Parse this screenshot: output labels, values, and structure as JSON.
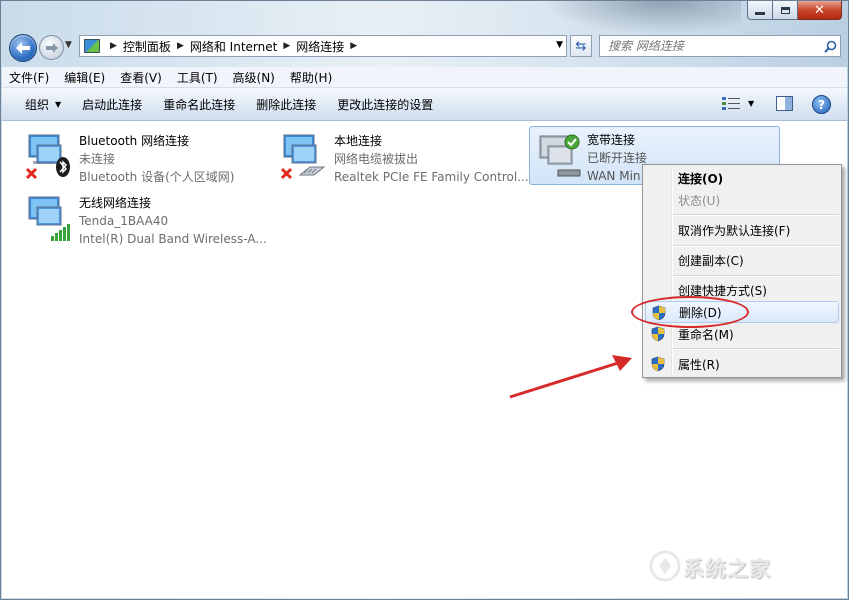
{
  "window": {
    "caption": {
      "close": "✕"
    }
  },
  "address": {
    "crumbs": [
      "控制面板",
      "网络和 Internet",
      "网络连接"
    ]
  },
  "search": {
    "placeholder": "搜索 网络连接"
  },
  "menubar": {
    "items": [
      "文件(F)",
      "编辑(E)",
      "查看(V)",
      "工具(T)",
      "高级(N)",
      "帮助(H)"
    ]
  },
  "cmdbar": {
    "organize": "组织",
    "items": [
      "启动此连接",
      "重命名此连接",
      "删除此连接",
      "更改此连接的设置"
    ],
    "help": "?"
  },
  "connections": [
    {
      "name": "Bluetooth 网络连接",
      "status": "未连接",
      "device": "Bluetooth 设备(个人区域网)",
      "icon": "bluetooth-network-icon",
      "state": "disconnected"
    },
    {
      "name": "本地连接",
      "status": "网络电缆被拔出",
      "device": "Realtek PCIe FE Family Control...",
      "icon": "ethernet-network-icon",
      "state": "disconnected"
    },
    {
      "name": "宽带连接",
      "status": "已断开连接",
      "device": "WAN Min",
      "icon": "broadband-network-icon",
      "state": "selected"
    },
    {
      "name": "无线网络连接",
      "status": "Tenda_1BAA40",
      "device": "Intel(R) Dual Band Wireless-A...",
      "icon": "wireless-network-icon",
      "state": "connected"
    }
  ],
  "context_menu": {
    "items": [
      {
        "label": "连接(O)",
        "bold": true
      },
      {
        "label": "状态(U)",
        "disabled": true
      },
      {
        "label": "取消作为默认连接(F)"
      },
      {
        "label": "创建副本(C)"
      },
      {
        "label": "创建快捷方式(S)"
      },
      {
        "label": "删除(D)",
        "shield": true,
        "highlighted": true
      },
      {
        "label": "重命名(M)",
        "shield": true
      },
      {
        "label": "属性(R)",
        "shield": true
      }
    ]
  },
  "watermark": {
    "text": "系统之家"
  },
  "colors": {
    "annotation_red": "#d62a2a",
    "selection_blue": "#8bb3e0"
  }
}
